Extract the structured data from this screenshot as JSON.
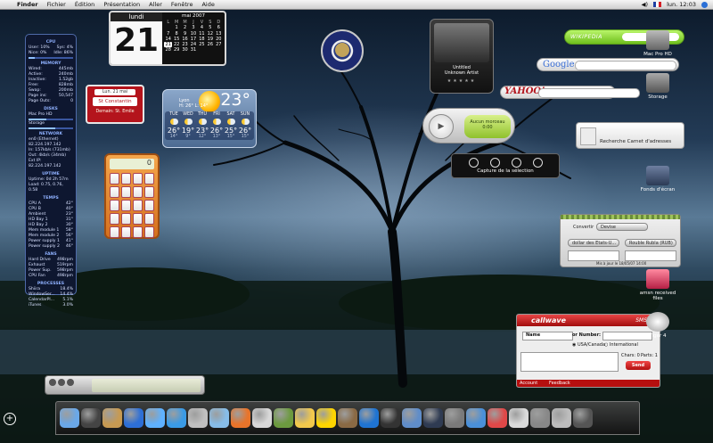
{
  "menubar": {
    "items": [
      "Finder",
      "Fichier",
      "Édition",
      "Présentation",
      "Aller",
      "Fenêtre",
      "Aide"
    ],
    "clock": "lun. 12:03"
  },
  "istat": {
    "cpu": {
      "title": "CPU",
      "user": "User: 10%",
      "sys": "Sys: 4%",
      "nice": "Nice: 0%",
      "idle": "Idle: 86%"
    },
    "memory": {
      "title": "MEMORY",
      "rows": [
        [
          "Wired:",
          "445mb"
        ],
        [
          "Active:",
          "240mb"
        ],
        [
          "Inactive:",
          "1.52gb"
        ],
        [
          "Free:",
          "828mb"
        ],
        [
          "Swap:",
          "200mb"
        ],
        [
          "Page ins:",
          "50,547"
        ],
        [
          "Page Outs:",
          "0"
        ]
      ]
    },
    "disks": {
      "title": "DISKS",
      "rows": [
        [
          "Mac Pro HD",
          ""
        ],
        [
          "Free",
          ""
        ],
        [
          "Storage",
          ""
        ],
        [
          "Free",
          ""
        ]
      ]
    },
    "network": {
      "title": "NETWORK",
      "iface": "en0 (Ethernet)",
      "ip": "82.224.197.142",
      "in": "In: 157kb/s (731mb)",
      "out": "Out: 4kb/s (34mb)",
      "ext": "Ext IP: 82.224.197.142"
    },
    "uptime": {
      "title": "UPTIME",
      "uptime": "Uptime: 0d 2h 57m",
      "load": "Load: 0.75, 0.76, 0.58"
    },
    "temps": {
      "title": "TEMPS",
      "rows": [
        [
          "CPU A",
          "42°"
        ],
        [
          "CPU B",
          "40°"
        ],
        [
          "Ambient",
          "23°"
        ],
        [
          "HD Bay 1",
          "31°"
        ],
        [
          "HD Bay 2",
          "30°"
        ],
        [
          "Mem module 1",
          "58°"
        ],
        [
          "Mem module 2",
          "56°"
        ],
        [
          "Power supply 1",
          "41°"
        ],
        [
          "Power supply 2",
          "46°"
        ]
      ]
    },
    "fans": {
      "title": "FANS",
      "rows": [
        [
          "Hard Drive",
          "498rpm"
        ],
        [
          "Exhaust",
          "519rpm"
        ],
        [
          "Power Sup.",
          "598rpm"
        ],
        [
          "CPU Fan",
          "498rpm"
        ]
      ]
    },
    "processes": {
      "title": "PROCESSES",
      "rows": [
        [
          "Shiira",
          "18.4%"
        ],
        [
          "WindowSer...",
          "14.4%"
        ],
        [
          "CalendarPl...",
          "5.1%"
        ],
        [
          "iTunes",
          "3.0%"
        ]
      ]
    }
  },
  "calendar": {
    "weekday": "lundi",
    "day": "21",
    "month_title": "mai 2007",
    "weekday_initials": [
      "L",
      "M",
      "M",
      "J",
      "V",
      "S",
      "D"
    ],
    "days": [
      "",
      "1",
      "2",
      "3",
      "4",
      "5",
      "6",
      "7",
      "8",
      "9",
      "10",
      "11",
      "12",
      "13",
      "14",
      "15",
      "16",
      "17",
      "18",
      "19",
      "20",
      "21",
      "22",
      "23",
      "24",
      "25",
      "26",
      "27",
      "28",
      "29",
      "30",
      "31",
      "",
      "",
      ""
    ]
  },
  "fete": {
    "date": "Lun. 21 mai",
    "saint": "St Constantin",
    "tomorrow": "Demain: St. Emile"
  },
  "weather": {
    "city": "Lyon",
    "hi_lo": "H: 26° L: 14°",
    "current": "23°",
    "days": [
      {
        "name": "TUE",
        "hi": "26°",
        "lo": "14°"
      },
      {
        "name": "WED",
        "hi": "19°",
        "lo": "9°"
      },
      {
        "name": "THU",
        "hi": "23°",
        "lo": "12°"
      },
      {
        "name": "FRI",
        "hi": "26°",
        "lo": "13°"
      },
      {
        "name": "SAT",
        "hi": "25°",
        "lo": "15°"
      },
      {
        "name": "SUN",
        "hi": "26°",
        "lo": "15°"
      }
    ]
  },
  "calculator": {
    "display": "0"
  },
  "itunes_widget": {
    "title": "Untitled",
    "artist": "Unknown Artist",
    "stars": "★★★★★"
  },
  "search": {
    "wikipedia_label": "WIKIPEDIA",
    "google_label": "Google",
    "yahoo_label": "YAHOO!"
  },
  "player": {
    "status": "Aucun morceau",
    "time": "0:00"
  },
  "addressbook": {
    "label": "Recherche Carnet d'adresses"
  },
  "capture": {
    "label": "Capture de la sélection"
  },
  "converter": {
    "type_label": "Convertir",
    "type_value": "Devise",
    "from": "dollar des Etats-U...",
    "to": "Rouble Rubla (RUB)",
    "updated": "Mis à jour le 18/05/07 14:00"
  },
  "callwave": {
    "logo": "callwave",
    "sms": "SMS",
    "name_select": "Name",
    "or_number": "or Number:",
    "usa": "USA/Canada",
    "intl": "International",
    "chars": "Chars: 0",
    "parts": "Parts: 1",
    "send": "Send",
    "account": "Account",
    "feedback": "Feedback"
  },
  "desktop_icons": [
    {
      "label": "Mac Pro HD"
    },
    {
      "label": "Storage"
    },
    {
      "label": "Fonds d'écran"
    },
    {
      "label": "amsn received files"
    },
    {
      "label": "Tiger 4"
    }
  ],
  "colors": {
    "accent": "#2a6fd6",
    "callwave_red": "#b60f0f",
    "wiki_green": "#6fbf1d"
  }
}
